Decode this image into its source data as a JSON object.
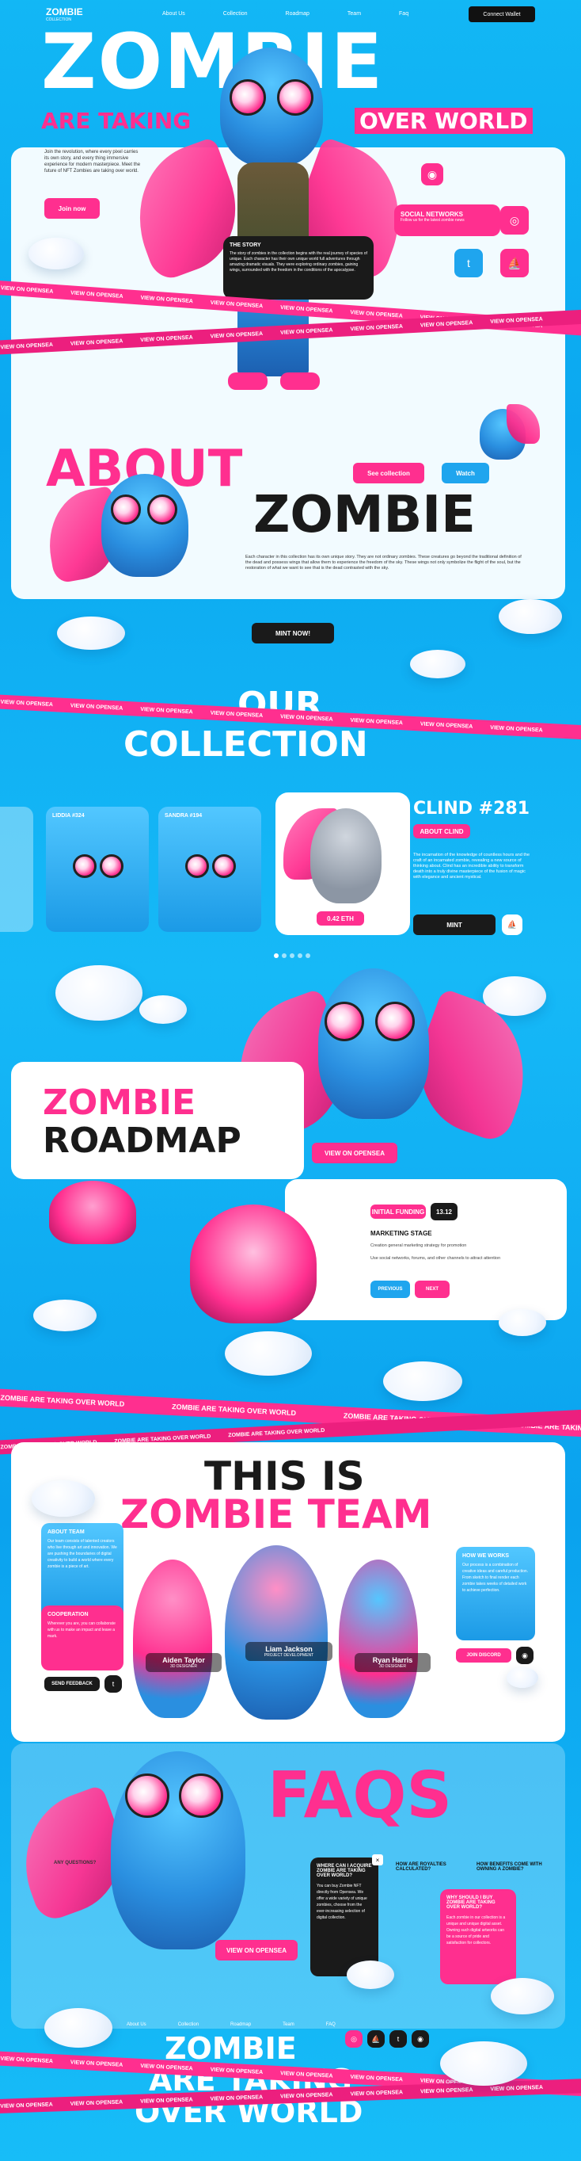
{
  "nav": {
    "logo_top": "ZOMBIE",
    "logo_bottom": "COLLECTION",
    "links": [
      "About Us",
      "Collection",
      "Roadmap",
      "Team",
      "Faq"
    ],
    "wallet_button": "Connect Wallet"
  },
  "hero": {
    "title": "ZOMBIE",
    "subtitle_left": "ARE TAKING",
    "subtitle_right": "OVER WORLD",
    "description": "Join the revolution, where every pixel carries its own story, and every thing  immersive experience for modern  masterpiece. Meet the future of NFT Zombies are taking over world.",
    "join_button": "Join now",
    "story_title": "THE STORY",
    "story_text": "The story of zombies in the collection begins with the real journey of species of unique. Each character has their own unique world full adventures through amazing dramatic visuals. They were exploring ordinary zombies, gaining wings, surrounded with the freedom in the conditions of the apocalypse.",
    "social_title": "SOCIAL NETWORKS",
    "social_sub": "Follow us for the latest zombie news"
  },
  "ribbon1": [
    "VIEW ON OPENSEA",
    "VIEW ON OPENSEA",
    "VIEW ON OPENSEA",
    "VIEW ON OPENSEA",
    "VIEW ON OPENSEA",
    "VIEW ON OPENSEA",
    "VIEW ON OPENSEA",
    "VIEW ON OPENSEA"
  ],
  "about": {
    "title_pink": "ABOUT",
    "title_dark": "ZOMBIE",
    "see_collection": "See collection",
    "watch": "Watch",
    "text": "Each character in this collection has its own unique story. They are not ordinary zombies. These creatures go beyond the traditional definition of the dead and possess wings that allow them to experience the freedom of the sky. These wings not only symbolize the flight of the soul, but the restoration of what we want to see that is the dead contrasted with the sky.",
    "mint_button": "MINT NOW!"
  },
  "collection": {
    "title_top": "OUR",
    "title_bottom": "COLLECTION",
    "cards": [
      {
        "name": "LIDDIA #324"
      },
      {
        "name": "SANDRA #194"
      }
    ],
    "featured_name": "CLIND #281",
    "about_button": "ABOUT CLIND",
    "featured_text": "The incarnation of the knowledge of countless hours and the craft of an incarnated zombie, revealing a new source of thinking about. Clind has an incredible ability to transform death into a truly divine masterpiece of the fusion of magic with elegance and ancient mystical.",
    "featured_tag": "0.42 ETH",
    "mint_button": "MINT"
  },
  "roadmap": {
    "title_pink": "ZOMBIE",
    "title_dark": "ROADMAP",
    "opensea_button": "VIEW ON OPENSEA",
    "phase_label": "INITIAL FUNDING",
    "phase_date": "13.12",
    "stage_title": "MARKETING STAGE",
    "stage_text_1": "Creation general marketing strategy for promotion",
    "stage_text_2": "Use social networks, forums, and other channels to attract attention",
    "prev_button": "PREVIOUS",
    "next_button": "NEXT"
  },
  "ribbon2": [
    "ZOMBIE ARE TAKING OVER WORLD",
    "ZOMBIE ARE TAKING OVER WORLD",
    "ZOMBIE ARE TAKING OVER WORLD",
    "ZOMBIE ARE TAKING OVER WORLD"
  ],
  "team": {
    "title_top": "THIS IS",
    "title_bottom": "ZOMBIE TEAM",
    "about_title": "ABOUT TEAM",
    "about_text": "Our team consists of talented creators who live through art and innovation. We are pushing the boundaries of digital creativity to build a world where every zombie is a piece of art.",
    "coop_title": "COOPERATION",
    "coop_text": "Wherever you are, you can collaborate with us to make an impact and leave a mark.",
    "send_feedback": "SEND FEEDBACK",
    "how_title": "HOW WE WORKS",
    "how_text": "Our process is a combination of creative ideas and careful production. From sketch to final render each zombie takes weeks of detailed work to achieve perfection.",
    "discord_button": "JOIN DISCORD",
    "members": [
      {
        "name": "Aiden Taylor",
        "role": "3D DESIGNER"
      },
      {
        "name": "Liam Jackson",
        "role": "PROJECT DEVELOPMENT"
      },
      {
        "name": "Ryan Harris",
        "role": "3D DESIGNER"
      }
    ]
  },
  "faq": {
    "title": "FAQS",
    "any_questions": "ANY QUESTIONS?",
    "opensea_button": "VIEW ON OPENSEA",
    "q1": "WHERE CAN I ACQUIRE ZOMBIE ARE TAKING OVER WORLD?",
    "a1": "You can buy Zombie NFT directly from Opensea. We offer a wide variety of unique zombies, choose from the ever-increasing selection of digital collection.",
    "q2": "HOW ARE ROYALTIES CALCULATED?",
    "q3": "HOW BENEFITS COME WITH OWNING A ZOMBIE?",
    "q4": "WHY SHOULD I BUY ZOMBIE ARE TAKING OVER WORLD?",
    "a4": "Each zombie in our collection is a unique and unique digital asset. Owning such digital artworks can be a source of pride and satisfaction for collectors."
  },
  "footer": {
    "links": [
      "About Us",
      "Collection",
      "Roadmap",
      "Team",
      "FAQ"
    ],
    "title_1": "ZOMBIE",
    "title_2": "ARE TAKING",
    "title_3": "OVER WORLD"
  },
  "ribbon3": [
    "VIEW ON OPENSEA",
    "VIEW ON OPENSEA",
    "VIEW ON OPENSEA",
    "VIEW ON OPENSEA",
    "VIEW ON OPENSEA",
    "VIEW ON OPENSEA",
    "VIEW ON OPENSEA",
    "VIEW ON OPENSEA"
  ],
  "colors": {
    "pink": "#ff2f8f",
    "sky": "#12b7f5",
    "dark": "#1a1a1a"
  }
}
